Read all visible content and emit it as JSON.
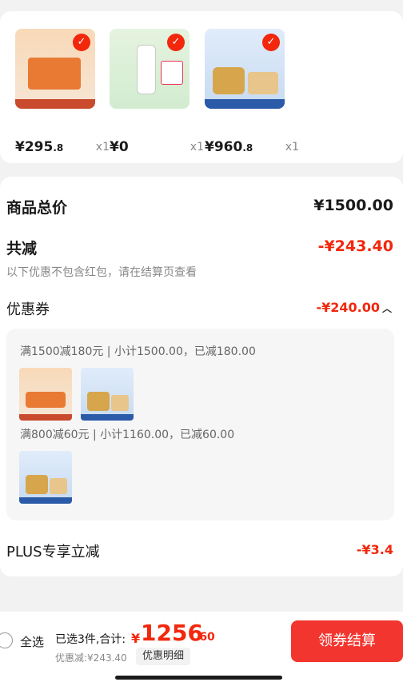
{
  "products": [
    {
      "price_int": "¥295",
      "price_dec": ".8",
      "qty": "x1",
      "icon": "check-icon"
    },
    {
      "price_int": "¥0",
      "price_dec": "",
      "qty": "x1",
      "icon": "check-icon"
    },
    {
      "price_int": "¥960",
      "price_dec": ".8",
      "qty": "x1",
      "icon": "check-icon"
    }
  ],
  "check_glyph": "✓",
  "summary": {
    "total_label": "商品总价",
    "total_value": "¥1500.00",
    "reduce_label": "共减",
    "reduce_value": "-¥243.40",
    "note": "以下优惠不包含红包，请在结算页查看",
    "coupon_label": "优惠券",
    "coupon_value": "-¥240.00",
    "coupon_chevron": "︿",
    "coupon_lines": [
      "满1500减180元 | 小计1500.00，已减180.00",
      "满800减60元 | 小计1160.00，已减60.00"
    ],
    "plus_label": "PLUS专享立减",
    "plus_value": "-¥3.4"
  },
  "bottom": {
    "select_all": "全选",
    "selected_text": "已选3件,合计:",
    "total_symbol": "¥",
    "total_int": "1256",
    "total_dec": ".60",
    "discount_text": "优惠减:¥243.40",
    "detail_label": "优惠明细",
    "checkout_label": "领券结算"
  },
  "colors": {
    "accent_red": "#f2270c",
    "button_red": "#f2352f"
  }
}
